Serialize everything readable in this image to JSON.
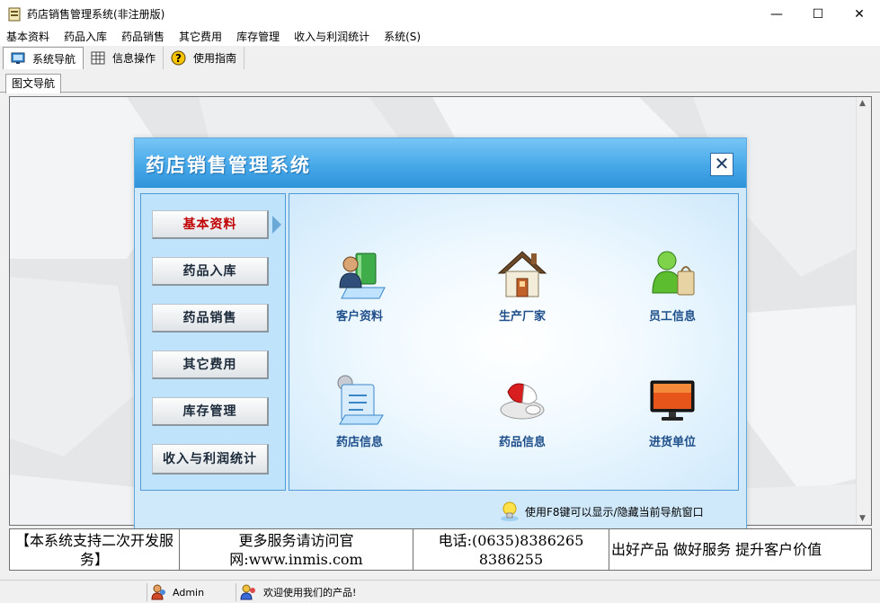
{
  "window": {
    "title": "药店销售管理系统(非注册版)",
    "controls": {
      "minimize": "—",
      "maximize": "☐",
      "close": "✕"
    }
  },
  "menu": [
    "基本资料",
    "药品入库",
    "药品销售",
    "其它费用",
    "库存管理",
    "收入与利润统计",
    "系统(S)"
  ],
  "toolbar": {
    "items": [
      {
        "label": "系统导航",
        "icon": "monitor-icon",
        "active": true
      },
      {
        "label": "信息操作",
        "icon": "grid-icon",
        "active": false
      },
      {
        "label": "使用指南",
        "icon": "help-icon",
        "active": false
      }
    ]
  },
  "tabs": [
    "图文导航"
  ],
  "dialog": {
    "title": "药店销售管理系统",
    "close_label": "✕",
    "nav": [
      "基本资料",
      "药品入库",
      "药品销售",
      "其它费用",
      "库存管理",
      "收入与利润统计"
    ],
    "selected_nav": "基本资料",
    "features": [
      {
        "label": "客户资料",
        "icon": "customer-icon"
      },
      {
        "label": "生产厂家",
        "icon": "house-icon"
      },
      {
        "label": "员工信息",
        "icon": "employee-icon"
      },
      {
        "label": "药店信息",
        "icon": "clipboard-icon"
      },
      {
        "label": "药品信息",
        "icon": "pill-icon"
      },
      {
        "label": "进货单位",
        "icon": "monitor-icon"
      }
    ],
    "footer_hint": "使用F8键可以显示/隐藏当前导航窗口"
  },
  "info": {
    "c1": "【本系统支持二次开发服务】",
    "c2_line1": "更多服务请访问官",
    "c2_line2": "网:www.inmis.com",
    "c3_line1": "电话:(0635)8386265",
    "c3_line2": "8386255",
    "c4": "出好产品 做好服务 提升客户价值"
  },
  "status": {
    "user": "Admin",
    "welcome": "欢迎使用我们的产品!"
  },
  "colors": {
    "accent": "#47a8e8",
    "selected_nav": "#c00000",
    "feature_label": "#1f4f8a"
  }
}
